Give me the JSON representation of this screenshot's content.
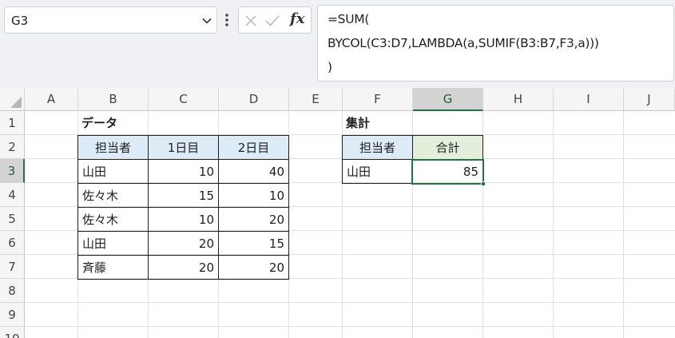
{
  "name_box": {
    "value": "G3"
  },
  "formula_bar": {
    "fx_label": "fx",
    "lines": [
      "=SUM(",
      "BYCOL(C3:D7,LAMBDA(a,SUMIF(B3:B7,F3,a)))",
      ")"
    ]
  },
  "columns": [
    "A",
    "B",
    "C",
    "D",
    "E",
    "F",
    "G",
    "H",
    "I",
    "J"
  ],
  "rows": [
    "1",
    "2",
    "3",
    "4",
    "5",
    "6",
    "7",
    "8",
    "9",
    "10"
  ],
  "selected_cell": {
    "column": "G",
    "row": "3"
  },
  "data_table": {
    "title": "データ",
    "headers": [
      "担当者",
      "1日目",
      "2日目"
    ],
    "rows": [
      [
        "山田",
        "10",
        "40"
      ],
      [
        "佐々木",
        "15",
        "10"
      ],
      [
        "佐々木",
        "10",
        "20"
      ],
      [
        "山田",
        "20",
        "15"
      ],
      [
        "斉藤",
        "20",
        "20"
      ]
    ]
  },
  "summary_table": {
    "title": "集計",
    "headers": [
      "担当者",
      "合計"
    ],
    "rows": [
      [
        "山田",
        "85"
      ]
    ]
  },
  "colors": {
    "accent": "#217346",
    "header_blue": "#ddebf7",
    "header_green": "#e2efda"
  },
  "icons": {
    "name_box_dropdown": "chevron-down-icon",
    "more": "vertical-dots-icon",
    "cancel": "close-icon",
    "enter": "check-icon"
  }
}
